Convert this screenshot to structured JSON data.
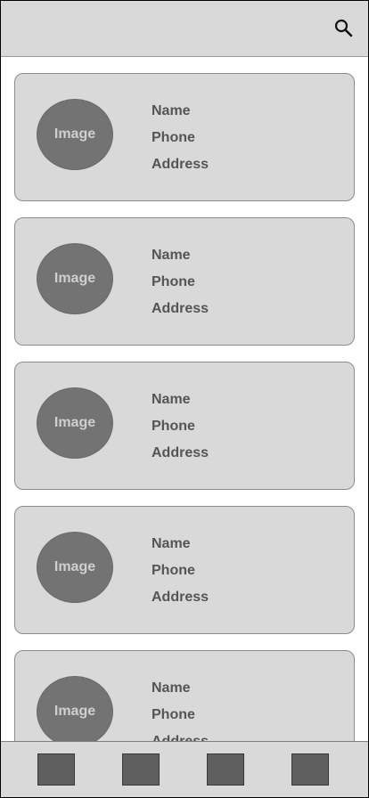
{
  "header": {
    "search_icon": "search-icon"
  },
  "cards": [
    {
      "image_label": "Image",
      "name_label": "Name",
      "phone_label": "Phone",
      "address_label": "Address"
    },
    {
      "image_label": "Image",
      "name_label": "Name",
      "phone_label": "Phone",
      "address_label": "Address"
    },
    {
      "image_label": "Image",
      "name_label": "Name",
      "phone_label": "Phone",
      "address_label": "Address"
    },
    {
      "image_label": "Image",
      "name_label": "Name",
      "phone_label": "Phone",
      "address_label": "Address"
    },
    {
      "image_label": "Image",
      "name_label": "Name",
      "phone_label": "Phone",
      "address_label": "Address"
    }
  ],
  "bottom_nav": {
    "items": [
      "nav-item-1",
      "nav-item-2",
      "nav-item-3",
      "nav-item-4"
    ]
  },
  "colors": {
    "bar_background": "#d9d9d9",
    "card_background": "#d9d9d9",
    "avatar_fill": "#737373",
    "text": "#555555",
    "nav_button_fill": "#5f5f5f"
  }
}
